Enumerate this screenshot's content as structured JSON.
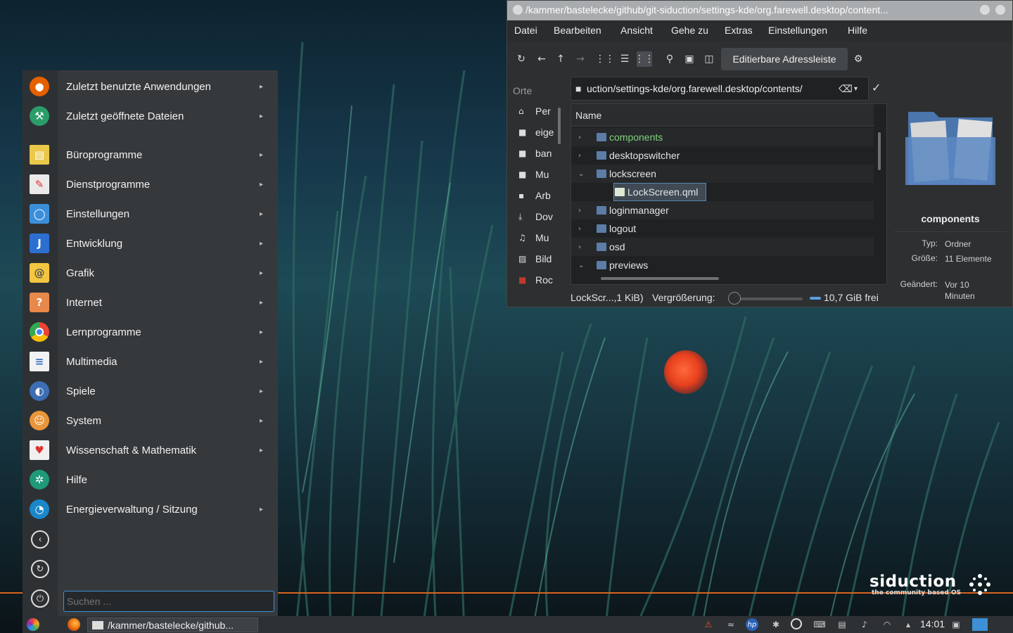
{
  "menu": {
    "items": [
      {
        "label": "Zuletzt benutzte Anwendungen",
        "icon": "firefox-icon",
        "color": "#e66000",
        "submenu": true
      },
      {
        "label": "Zuletzt geöffnete Dateien",
        "icon": "tools-icon",
        "color": "#2a9d6a",
        "submenu": true
      },
      {
        "label": "Büroprogramme",
        "icon": "office-icon",
        "color": "#e9c84a",
        "submenu": true
      },
      {
        "label": "Dienstprogramme",
        "icon": "utilities-icon",
        "color": "#eaeaea",
        "submenu": true
      },
      {
        "label": "Einstellungen",
        "icon": "settings-icon",
        "color": "#3b8fd9",
        "submenu": true
      },
      {
        "label": "Entwicklung",
        "icon": "development-icon",
        "color": "#2d6fd1",
        "submenu": true
      },
      {
        "label": "Grafik",
        "icon": "graphics-icon",
        "color": "#f3c640",
        "submenu": true
      },
      {
        "label": "Internet",
        "icon": "internet-icon",
        "color": "#e8884a",
        "submenu": true
      },
      {
        "label": "Lernprogramme",
        "icon": "education-icon",
        "color": "#4285f4",
        "submenu": true
      },
      {
        "label": "Multimedia",
        "icon": "multimedia-icon",
        "color": "#3a6fc4",
        "submenu": true
      },
      {
        "label": "Spiele",
        "icon": "games-icon",
        "color": "#3d6db5",
        "submenu": true
      },
      {
        "label": "System",
        "icon": "system-icon",
        "color": "#e8963a",
        "submenu": true
      },
      {
        "label": "Wissenschaft & Mathematik",
        "icon": "science-icon",
        "color": "#f0f0f0",
        "submenu": true
      },
      {
        "label": "Hilfe",
        "icon": "help-icon",
        "color": "#1f9a78",
        "submenu": false
      },
      {
        "label": "Energieverwaltung / Sitzung",
        "icon": "power-session-icon",
        "color": "#1b87c9",
        "submenu": true
      }
    ],
    "search_placeholder": "Suchen ..."
  },
  "window": {
    "title": "/kammer/bastelecke/github/git-siduction/settings-kde/org.farewell.desktop/content...",
    "menubar": [
      "Datei",
      "Bearbeiten",
      "Ansicht",
      "Gehe zu",
      "Extras",
      "Einstellungen",
      "Hilfe"
    ],
    "address_button": "Editierbare Adressleiste",
    "places_header": "Orte",
    "places": [
      {
        "label": "Per",
        "icon": "home-icon"
      },
      {
        "label": "eige",
        "icon": "folder-icon"
      },
      {
        "label": "ban",
        "icon": "folder-icon"
      },
      {
        "label": "Mu",
        "icon": "folder-icon"
      },
      {
        "label": "Arb",
        "icon": "desktop-icon"
      },
      {
        "label": "Dov",
        "icon": "download-icon"
      },
      {
        "label": "Mu",
        "icon": "music-icon"
      },
      {
        "label": "Bild",
        "icon": "image-icon"
      },
      {
        "label": "Roc",
        "icon": "folder-red-icon"
      }
    ],
    "path": "uction/settings-kde/org.farewell.desktop/contents/",
    "column_header": "Name",
    "tree": [
      {
        "name": "components",
        "expanded": false,
        "highlight": true
      },
      {
        "name": "desktopswitcher",
        "expanded": false
      },
      {
        "name": "lockscreen",
        "expanded": true
      },
      {
        "name": "LockScreen.qml",
        "child": true,
        "selected": true
      },
      {
        "name": "loginmanager",
        "expanded": false
      },
      {
        "name": "logout",
        "expanded": false
      },
      {
        "name": "osd",
        "expanded": false
      },
      {
        "name": "previews",
        "expanded": true
      }
    ],
    "info": {
      "title": "components",
      "type_key": "Typ:",
      "type_val": "Ordner",
      "size_key": "Größe:",
      "size_val": "11 Elemente",
      "changed_key": "Geändert:",
      "changed_val": "Vor 10 Minuten"
    },
    "status": {
      "file": "LockScr...,1 KiB)",
      "zoom_label": "Vergrößerung:",
      "free": "10,7 GiB frei"
    }
  },
  "taskbar": {
    "window_label": "/kammer/bastelecke/github...",
    "clock": "14:01"
  },
  "branding": {
    "name": "siduction",
    "tagline": "the community based OS"
  },
  "colors": {
    "accent": "#3d8fd6",
    "highlight_green": "#7fd47a",
    "brand_orange": "#d9631e"
  }
}
